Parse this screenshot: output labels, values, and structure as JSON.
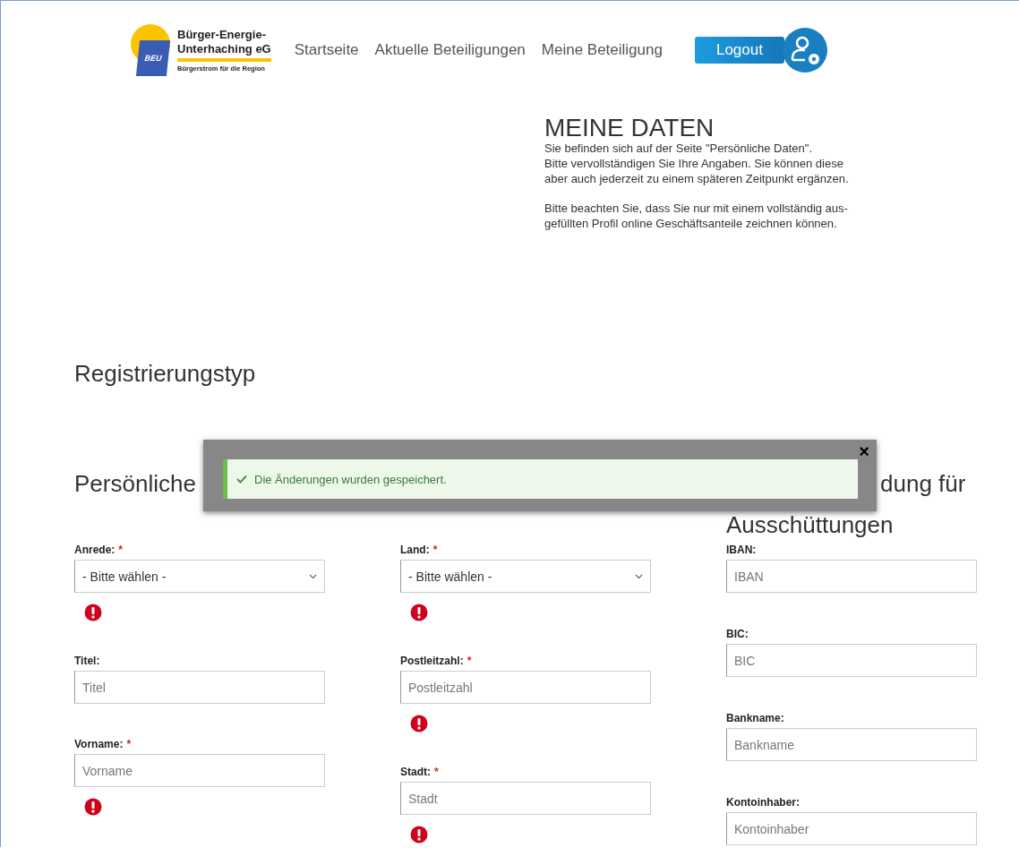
{
  "header": {
    "logo": {
      "badge": "BEU",
      "name_lines": [
        "Bürger-Energie-",
        "Unterhaching eG"
      ],
      "tagline": "Bürgerstrom für die Region"
    },
    "nav": [
      "Startseite",
      "Aktuelle Beteiligungen",
      "Meine Beteiligung"
    ],
    "logout": "Logout"
  },
  "intro": {
    "title": "MEINE DATEN",
    "paragraphs": [
      "Sie befinden sich auf der Seite \"Persönliche Daten\".\nBitte vervollständigen Sie Ihre Angaben. Sie können diese\naber auch jederzeit zu einem späteren Zeitpunkt ergänzen.",
      "Bitte beachten Sie, dass Sie nur mit einem vollständig aus-\ngefüllten Profil online Geschäftsanteile zeichnen können."
    ]
  },
  "registration_heading": "Registrierungstyp",
  "columns": [
    {
      "heading_lines": [
        "Persönliche"
      ],
      "fields": [
        {
          "label": "Anrede:",
          "required_mark": "*",
          "kind": "select",
          "value": "- Bitte wählen -",
          "error": true
        },
        {
          "label": "Titel:",
          "kind": "input",
          "placeholder": "Titel",
          "error": false
        },
        {
          "label": "Vorname:",
          "required_mark": "*",
          "kind": "input",
          "placeholder": "Vorname",
          "error": true
        }
      ]
    },
    {
      "fields": [
        {
          "label": "Land:",
          "required_mark": "*",
          "kind": "select",
          "value": "- Bitte wählen -",
          "error": true
        },
        {
          "label": "Postleitzahl:",
          "required_mark": "*",
          "kind": "input",
          "placeholder": "Postleitzahl",
          "error": true
        },
        {
          "label": "Stadt:",
          "required_mark": "*",
          "kind": "input",
          "placeholder": "Stadt",
          "error": true
        }
      ]
    },
    {
      "heading_lines": [
        "dung für",
        "Ausschüttungen"
      ],
      "fields": [
        {
          "label": "IBAN:",
          "kind": "input",
          "placeholder": "IBAN",
          "error": false
        },
        {
          "label": "BIC:",
          "kind": "input",
          "placeholder": "BIC",
          "error": false
        },
        {
          "label": "Bankname:",
          "kind": "input",
          "placeholder": "Bankname",
          "error": false
        },
        {
          "label": "Kontoinhaber:",
          "kind": "input",
          "placeholder": "Kontoinhaber",
          "error": false
        }
      ]
    }
  ],
  "toast": {
    "message": "Die Änderungen wurden gespeichert.",
    "close": "×"
  }
}
